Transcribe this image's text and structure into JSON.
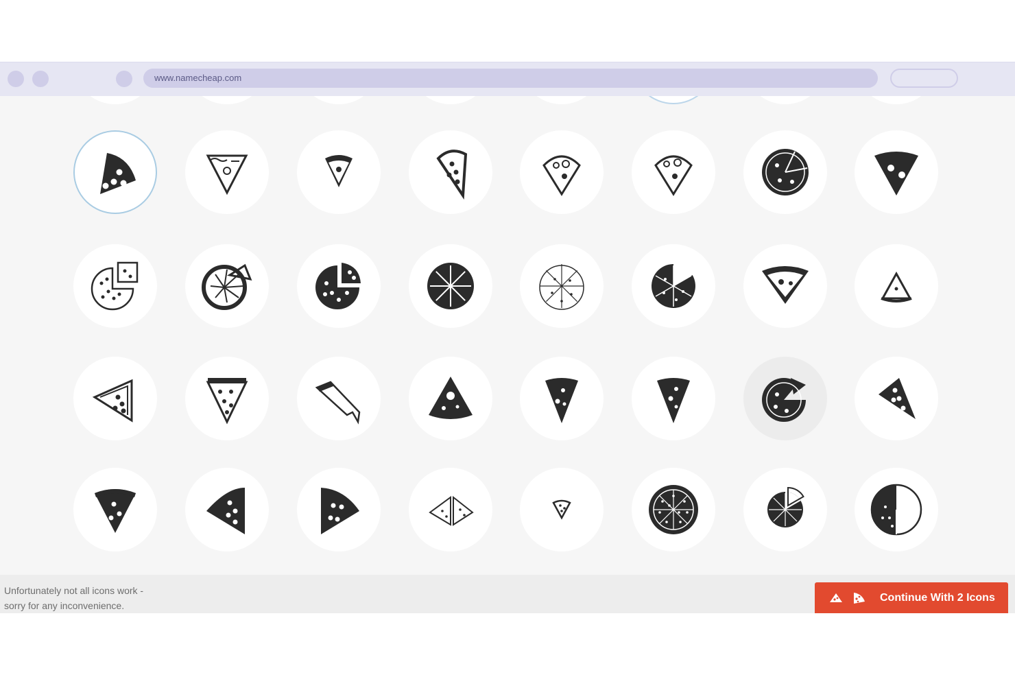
{
  "browser": {
    "url": "www.namecheap.com"
  },
  "icons": [
    "pizza-slice-bold-selected",
    "pizza-slice-outline-lines",
    "pizza-slice-small-outline",
    "pizza-slice-thick-crust-outline",
    "pizza-slice-bitten-outline",
    "pizza-slice-bitten-outline-alt",
    "whole-pizza-cut-dark",
    "pizza-slice-solid-wide",
    "pizza-missing-slice-outline",
    "pizza-wheel-slice-lifted",
    "pizza-missing-slice-dark",
    "whole-pizza-wheel-dark",
    "pizza-8-slices-outline",
    "pizza-missing-slice-dark-alt",
    "pizza-slice-wide-outline",
    "pizza-slice-small-triangle",
    "pizza-slice-sideways-outline",
    "pizza-slice-crust-detailed",
    "pizza-slice-dripping",
    "pizza-slice-mushroom",
    "pizza-slice-solid-narrow",
    "pizza-slice-solid-narrow-alt",
    "pizza-cut-slice-hover",
    "pizza-slice-sideways-solid",
    "pizza-slice-simple-solid",
    "pizza-slice-left-solid",
    "pizza-slice-right-solid",
    "two-pizza-slices-outline",
    "pizza-slice-tiny",
    "whole-pizza-dotted",
    "whole-pizza-small-cut",
    "pizza-quarter-circle-outline"
  ],
  "colors": {
    "icon": "#2b2b2b",
    "accent": "#e24a2f",
    "selected_ring": "#a9cce3",
    "browser_bar": "#e6e6f3"
  },
  "footer": {
    "note_line1": "Unfortunately not all icons work -",
    "note_line2": "sorry for any inconvenience.",
    "selected_count": 2,
    "continue_label": "Continue With 2 Icons"
  }
}
